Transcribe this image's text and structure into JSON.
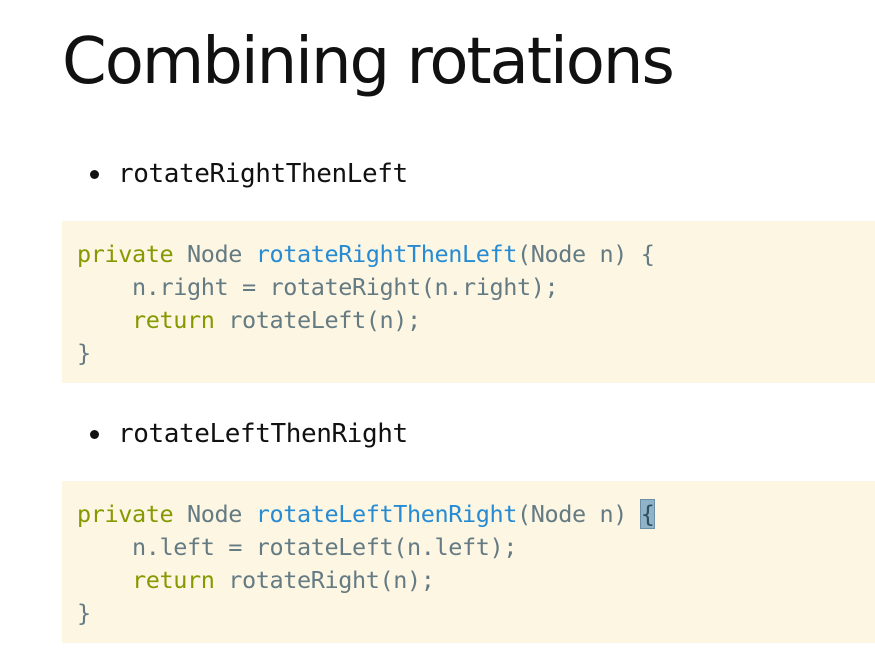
{
  "slide": {
    "title": "Combining rotations"
  },
  "sections": [
    {
      "bullet": "rotateRightThenLeft",
      "code": [
        [
          {
            "text": "private",
            "role": "keyword"
          },
          {
            "text": " Node ",
            "role": "plain"
          },
          {
            "text": "rotateRightThenLeft",
            "role": "function"
          },
          {
            "text": "(Node n) ",
            "role": "plain"
          },
          {
            "text": "{",
            "role": "plain"
          }
        ],
        [
          {
            "text": "    n.right = rotateRight(n.right);",
            "role": "plain"
          }
        ],
        [
          {
            "text": "    ",
            "role": "plain"
          },
          {
            "text": "return",
            "role": "keyword"
          },
          {
            "text": " rotateLeft(n);",
            "role": "plain"
          }
        ],
        [
          {
            "text": "}",
            "role": "plain"
          }
        ]
      ]
    },
    {
      "bullet": "rotateLeftThenRight",
      "code": [
        [
          {
            "text": "private",
            "role": "keyword"
          },
          {
            "text": " Node ",
            "role": "plain"
          },
          {
            "text": "rotateLeftThenRight",
            "role": "function"
          },
          {
            "text": "(Node n) ",
            "role": "plain"
          },
          {
            "text": "{",
            "role": "cursor"
          }
        ],
        [
          {
            "text": "    n.left = rotateLeft(n.left);",
            "role": "plain"
          }
        ],
        [
          {
            "text": "    ",
            "role": "plain"
          },
          {
            "text": "return",
            "role": "keyword"
          },
          {
            "text": " rotateRight(n);",
            "role": "plain"
          }
        ],
        [
          {
            "text": "}",
            "role": "plain"
          }
        ]
      ]
    }
  ],
  "colors": {
    "code_background": "#fdf6e3",
    "code_plain": "#657b83",
    "code_keyword": "#859900",
    "code_function": "#268bd2",
    "text": "#111111"
  }
}
